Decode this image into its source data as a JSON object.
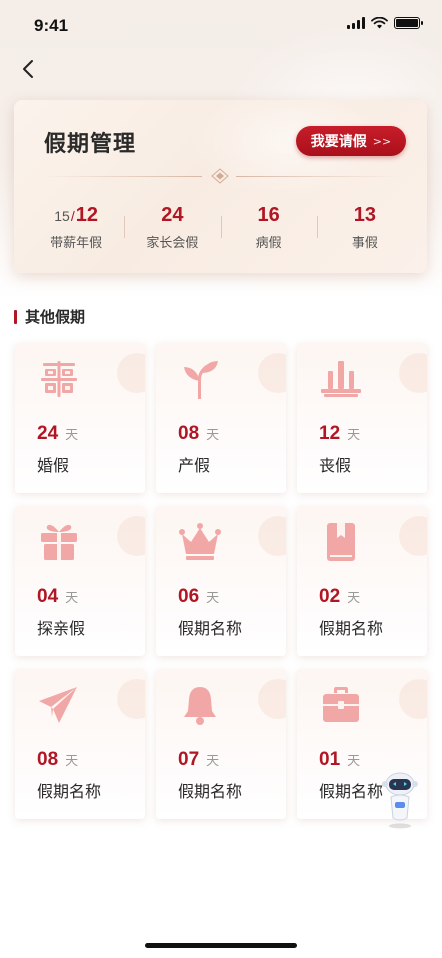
{
  "status_bar": {
    "time": "9:41"
  },
  "summary": {
    "title": "假期管理",
    "apply_button": "我要请假",
    "apply_arrows": ">>",
    "annual": {
      "used": "15",
      "sep": "/",
      "total": "12",
      "label": "带薪年假"
    },
    "stats": [
      {
        "value": "24",
        "label": "家长会假"
      },
      {
        "value": "16",
        "label": "病假"
      },
      {
        "value": "13",
        "label": "事假"
      }
    ]
  },
  "section": {
    "title": "其他假期"
  },
  "day_unit": "天",
  "tiles": [
    {
      "icon": "double-happiness-icon",
      "days": "24",
      "name": "婚假"
    },
    {
      "icon": "sprout-icon",
      "days": "08",
      "name": "产假"
    },
    {
      "icon": "memorial-icon",
      "days": "12",
      "name": "丧假"
    },
    {
      "icon": "gift-icon",
      "days": "04",
      "name": "探亲假"
    },
    {
      "icon": "crown-icon",
      "days": "06",
      "name": "假期名称"
    },
    {
      "icon": "book-icon",
      "days": "02",
      "name": "假期名称"
    },
    {
      "icon": "paper-plane-icon",
      "days": "08",
      "name": "假期名称"
    },
    {
      "icon": "bell-icon",
      "days": "07",
      "name": "假期名称"
    },
    {
      "icon": "briefcase-icon",
      "days": "01",
      "name": "假期名称"
    }
  ],
  "colors": {
    "accent": "#b01624",
    "icon_tint": "#f2a7a7",
    "card_bg": "#f8ece2"
  }
}
